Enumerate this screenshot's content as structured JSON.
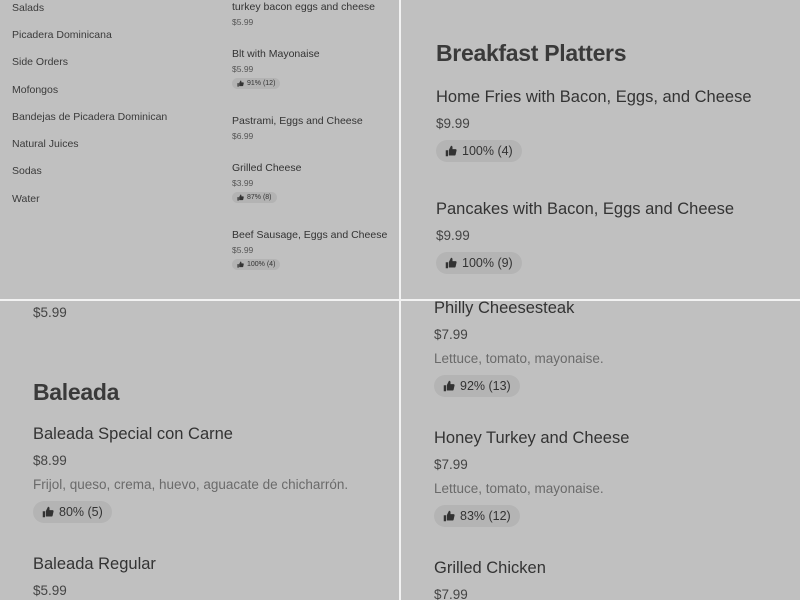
{
  "categories": [
    "Salads",
    "Picadera Dominicana",
    "Side Orders",
    "Mofongos",
    "Bandejas de Picadera Dominican",
    "Natural Juices",
    "Sodas",
    "Water"
  ],
  "mini_items": [
    {
      "title": "turkey bacon eggs and cheese",
      "price": "$5.99",
      "rating": ""
    },
    {
      "title": "Blt with Mayonaise",
      "price": "$5.99",
      "rating": "91% (12)"
    },
    {
      "title": "Pastrami, Eggs and Cheese",
      "price": "$6.99",
      "rating": ""
    },
    {
      "title": "Grilled Cheese",
      "price": "$3.99",
      "rating": "87% (8)"
    },
    {
      "title": "Beef Sausage, Eggs and Cheese",
      "price": "$5.99",
      "rating": "100% (4)"
    }
  ],
  "breakfast": {
    "heading": "Breakfast Platters",
    "items": [
      {
        "title": "Home Fries with Bacon, Eggs, and Cheese",
        "price": "$9.99",
        "rating": "100% (4)"
      },
      {
        "title": "Pancakes with Bacon, Eggs and Cheese",
        "price": "$9.99",
        "rating": "100% (9)"
      }
    ]
  },
  "left_lower": {
    "partial_price": "$5.99",
    "heading": "Baleada",
    "items": [
      {
        "title": "Baleada Special con Carne",
        "price": "$8.99",
        "desc": "Frijol, queso, crema, huevo, aguacate de chicharrón.",
        "rating": "80% (5)"
      },
      {
        "title": "Baleada Regular",
        "price": "$5.99"
      }
    ]
  },
  "right_lower": {
    "items": [
      {
        "title": "Philly Cheesesteak",
        "price": "$7.99",
        "desc": "Lettuce, tomato, mayonaise.",
        "rating": "92% (13)"
      },
      {
        "title": "Honey Turkey and Cheese",
        "price": "$7.99",
        "desc": "Lettuce, tomato, mayonaise.",
        "rating": "83% (12)"
      },
      {
        "title": "Grilled Chicken",
        "price": "$7.99"
      }
    ]
  }
}
